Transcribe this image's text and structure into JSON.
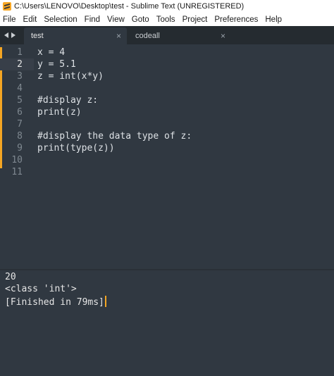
{
  "window": {
    "title": "C:\\Users\\LENOVO\\Desktop\\test - Sublime Text (UNREGISTERED)",
    "app_icon": "sublime-text-icon"
  },
  "menu": [
    "File",
    "Edit",
    "Selection",
    "Find",
    "View",
    "Goto",
    "Tools",
    "Project",
    "Preferences",
    "Help"
  ],
  "tabs": [
    {
      "label": "test",
      "close": "×",
      "active": true
    },
    {
      "label": "codeall",
      "close": "×",
      "active": false
    }
  ],
  "editor": {
    "current_line": 2,
    "lines": [
      {
        "num": "1",
        "text": "x = 4"
      },
      {
        "num": "2",
        "text": "y = 5.1"
      },
      {
        "num": "3",
        "text": "z = int(x*y)"
      },
      {
        "num": "4",
        "text": ""
      },
      {
        "num": "5",
        "text": "#display z:"
      },
      {
        "num": "6",
        "text": "print(z)"
      },
      {
        "num": "7",
        "text": ""
      },
      {
        "num": "8",
        "text": "#display the data type of z:"
      },
      {
        "num": "9",
        "text": "print(type(z))"
      },
      {
        "num": "10",
        "text": ""
      },
      {
        "num": "11",
        "text": ""
      }
    ]
  },
  "output": {
    "lines": [
      "20",
      "<class 'int'>",
      "[Finished in 79ms]"
    ]
  },
  "colors": {
    "editor_bg": "#303841",
    "tabbar_bg": "#252b30",
    "modified_marker": "#f5a623",
    "text": "#dde1e5"
  }
}
